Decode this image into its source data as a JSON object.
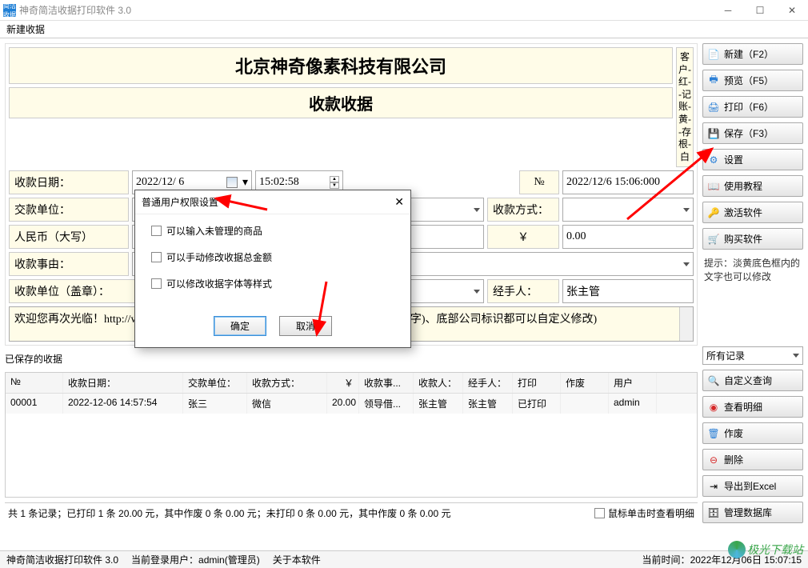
{
  "app": {
    "title": "神奇简洁收据打印软件 3.0",
    "icon_text": "简洁收据"
  },
  "menu": {
    "new_receipt_tab": "新建收据"
  },
  "receipt": {
    "company": "北京神奇像素科技有限公司",
    "doc_title": "收款收据",
    "side_labels": "客户-红--记账-黄--存根-白",
    "labels": {
      "date": "收款日期：",
      "payer": "交款单位：",
      "rmb": "人民币（大写）",
      "reason": "收款事由：",
      "payee_seal": "收款单位（盖章）：",
      "method": "收款方式：",
      "yen": "￥",
      "no": "№",
      "handler": "经手人："
    },
    "values": {
      "date": "2022/12/ 6",
      "time": "15:02:58",
      "serial": "2022/12/6 15:06:000",
      "amount": "0.00",
      "handler": "张主管"
    },
    "footer_text": "欢迎您再次光临！http://www.shenqixiangsu.com (收据标题、底部备注(就是本段文字)、底部公司标识都可以自定义修改)"
  },
  "saved": {
    "label": "已保存的收据",
    "columns": {
      "no": "№",
      "date": "收款日期：",
      "unit": "交款单位：",
      "method": "收款方式：",
      "amt": "￥",
      "reason": "收款事...",
      "payee": "收款人：",
      "handler": "经手人：",
      "print": "打印",
      "void": "作废",
      "user": "用户"
    },
    "rows": [
      {
        "no": "00001",
        "date": "2022-12-06 14:57:54",
        "unit": "张三",
        "method": "微信",
        "amt": "20.00",
        "reason": "领导借...",
        "payee": "张主管",
        "handler": "张主管",
        "print": "已打印",
        "void": "",
        "user": "admin"
      }
    ],
    "stats": "共 1 条记录；已打印 1 条 20.00 元，其中作废 0 条 0.00 元；未打印 0 条 0.00 元，其中作废 0 条 0.00 元",
    "hover_check": "鼠标单击时查看明细"
  },
  "rightbar": {
    "new": "新建（F2）",
    "preview": "预览（F5）",
    "print": "打印（F6）",
    "save": "保存（F3）",
    "settings": "设置",
    "tutorial": "使用教程",
    "activate": "激活软件",
    "buy": "购买软件",
    "hint": "提示：淡黄底色框内的文字也可以修改",
    "all_records": "所有记录",
    "custom_query": "自定义查询",
    "view_detail": "查看明细",
    "void": "作废",
    "delete": "删除",
    "export": "导出到Excel",
    "manage_db": "管理数据库"
  },
  "dialog": {
    "title": "普通用户权限设置",
    "opt1": "可以输入未管理的商品",
    "opt2": "可以手动修改收据总金额",
    "opt3": "可以修改收据字体等样式",
    "ok": "确定",
    "cancel": "取消"
  },
  "statusbar": {
    "app": "神奇简洁收据打印软件 3.0",
    "user": "当前登录用户：admin(管理员)",
    "about": "关于本软件",
    "time_label": "当前时间：",
    "time": "2022年12月06日 15:07:15"
  },
  "watermark": "极光下载站"
}
